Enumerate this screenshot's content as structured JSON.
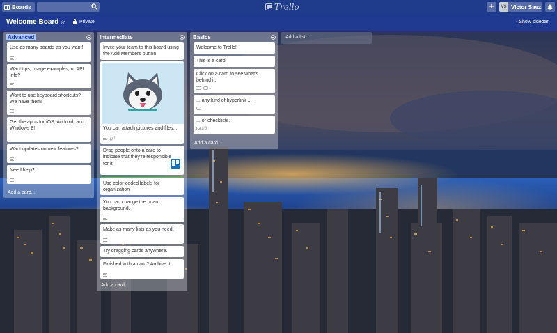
{
  "topbar": {
    "boards_label": "Boards",
    "search_value": "",
    "logo_text": "Trello",
    "add_label": "+",
    "member_initials": "VS",
    "member_name": "Victor Saez"
  },
  "board": {
    "title": "Welcome Board",
    "star": "☆",
    "visibility": "Private",
    "show_sidebar": "Show sidebar"
  },
  "lists": [
    {
      "title": "Advanced",
      "cards": [
        {
          "text": "Use as many boards as you want!"
        },
        {
          "text": "Want tips, usage examples, or API info?"
        },
        {
          "text": "Want to use keyboard shortcuts? We have them!"
        },
        {
          "text": "Get the apps for iOS, Android, and Windows 8!"
        },
        {
          "text": "Want updates on new features?"
        },
        {
          "text": "Need help?"
        }
      ],
      "add_card": "Add a card..."
    },
    {
      "title": "Intermediate",
      "cards": [
        {
          "text": "Invite your team to this board using the Add Members button"
        },
        {
          "text": "You can attach pictures and files...",
          "attachments": "1"
        },
        {
          "text": "Drag people onto a card to indicate that they're responsible for it."
        },
        {
          "text": "Use color-coded labels for organization"
        },
        {
          "text": "You can change the board background."
        },
        {
          "text": "Make as many lists as you need!"
        },
        {
          "text": "Try dragging cards anywhere."
        },
        {
          "text": "Finished with a card? Archive it."
        }
      ],
      "add_card": "Add a card..."
    },
    {
      "title": "Basics",
      "cards": [
        {
          "text": "Welcome to Trello!"
        },
        {
          "text": "This is a card."
        },
        {
          "text": "Click on a card to see what's behind it.",
          "comments": "1"
        },
        {
          "text": "... any kind of hyperlink ...",
          "comments": "1"
        },
        {
          "text": "... or checklists.",
          "checklist": "1/3"
        }
      ],
      "add_card": "Add a card..."
    }
  ],
  "add_list": "Add a list..."
}
